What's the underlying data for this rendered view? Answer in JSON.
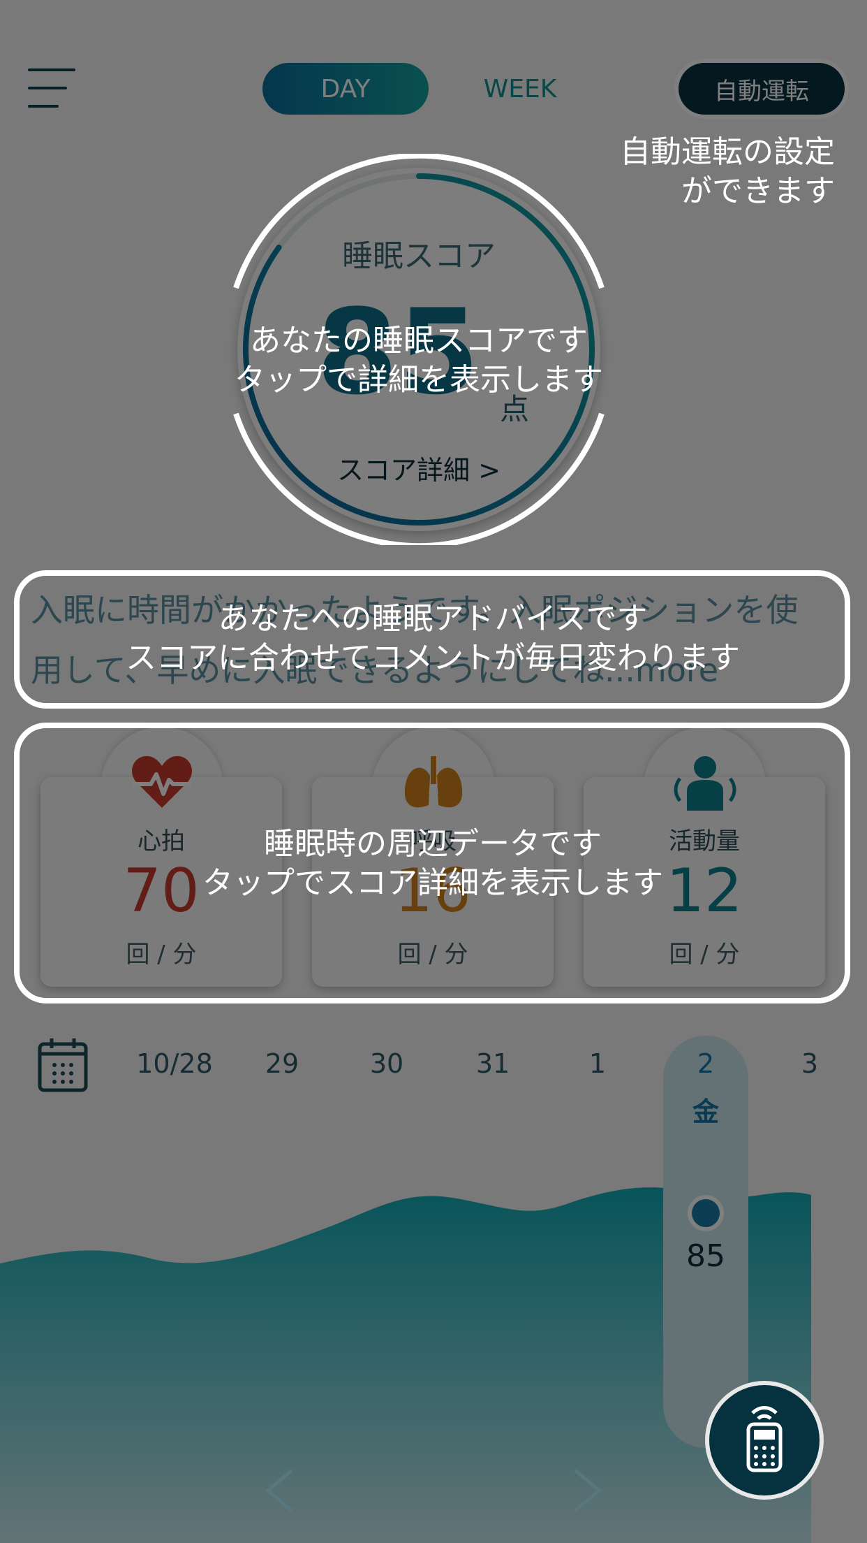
{
  "header": {
    "tab_day": "DAY",
    "tab_week": "WEEK",
    "auto_button": "自動運転"
  },
  "score": {
    "title": "睡眠スコア",
    "value": "85",
    "unit": "点",
    "link": "スコア詳細 >",
    "progress_percent": 85
  },
  "advice": {
    "line1": "入眠に時間がかかったようです。入眠ポジションを使",
    "line2": "用して、早めに入眠できるようにしてね...more"
  },
  "metrics": [
    {
      "label": "心拍",
      "value": "70",
      "unit": "回 / 分",
      "icon": "heart-pulse-icon",
      "color": "#c73b2f"
    },
    {
      "label": "呼吸",
      "value": "16",
      "unit": "回 / 分",
      "icon": "lungs-icon",
      "color": "#d1801a"
    },
    {
      "label": "活動量",
      "value": "12",
      "unit": "回 / 分",
      "icon": "person-motion-icon",
      "color": "#0f7f8f"
    }
  ],
  "dates": [
    "10/28",
    "29",
    "30",
    "31",
    "1"
  ],
  "selected": {
    "date": "2",
    "weekday": "金",
    "score": "85"
  },
  "next_date": "3",
  "tips": {
    "auto_line1": "自動運転の設定",
    "auto_line2": "ができます",
    "score_line1": "あなたの睡眠スコアです",
    "score_line2": "タップで詳細を表示します",
    "advice_line1": "あなたへの睡眠アドバイスです",
    "advice_line2": "スコアに合わせてコメントが毎日変わります",
    "data_line1": "睡眠時の周辺データです",
    "data_line2": "タップでスコア詳細を表示します"
  },
  "colors": {
    "accent": "#0f7f8f",
    "dark": "#06323f"
  }
}
